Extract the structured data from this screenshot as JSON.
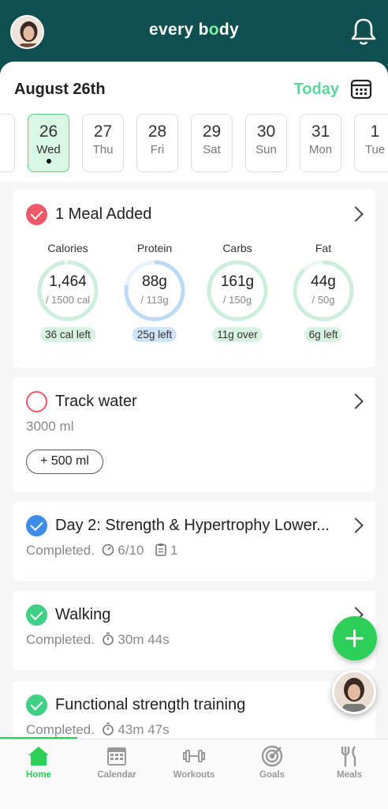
{
  "header": {
    "brand_pre": "every b",
    "brand_o": "o",
    "brand_post": "dy"
  },
  "dates": {
    "title": "August 26th",
    "today_label": "Today",
    "days": [
      {
        "num": "26",
        "name": "Wed",
        "selected": true
      },
      {
        "num": "27",
        "name": "Thu"
      },
      {
        "num": "28",
        "name": "Fri"
      },
      {
        "num": "29",
        "name": "Sat"
      },
      {
        "num": "30",
        "name": "Sun"
      },
      {
        "num": "31",
        "name": "Mon"
      },
      {
        "num": "1",
        "name": "Tue"
      }
    ]
  },
  "meals": {
    "title": "1 Meal Added",
    "macros": [
      {
        "label": "Calories",
        "value": "1,464",
        "total": "/ 1500 cal",
        "remaining": "36 cal left",
        "fraction": 0.98,
        "ring_color": "#cdeedd",
        "pill_color": "#d8f3e2"
      },
      {
        "label": "Protein",
        "value": "88g",
        "total": "/ 113g",
        "remaining": "25g left",
        "fraction": 0.78,
        "ring_color": "#bcd9f5",
        "pill_color": "#cfe4f8"
      },
      {
        "label": "Carbs",
        "value": "161g",
        "total": "/ 150g",
        "remaining": "11g over",
        "fraction": 1.0,
        "ring_color": "#cdeedd",
        "pill_color": "#d8f3e2"
      },
      {
        "label": "Fat",
        "value": "44g",
        "total": "/ 50g",
        "remaining": "6g left",
        "fraction": 0.88,
        "ring_color": "#cdeedd",
        "pill_color": "#d8f3e2"
      }
    ]
  },
  "water": {
    "title": "Track water",
    "amount": "3000 ml",
    "add_button": "+ 500 ml"
  },
  "workout": {
    "title": "Day 2: Strength & Hypertrophy Lower...",
    "status": "Completed.",
    "score": "6/10",
    "notes": "1"
  },
  "walking": {
    "title": "Walking",
    "status": "Completed.",
    "duration": "30m 44s"
  },
  "functional": {
    "title": "Functional strength training",
    "status": "Completed.",
    "duration": "43m 47s"
  },
  "nav": [
    {
      "label": "Home",
      "active": true
    },
    {
      "label": "Calendar"
    },
    {
      "label": "Workouts"
    },
    {
      "label": "Goals"
    },
    {
      "label": "Meals"
    }
  ],
  "colors": {
    "brand_dark": "#0f4f4f",
    "accent_green": "#2ecf58",
    "today_green": "#5ad69e",
    "alert_red": "#ef5868",
    "check_green": "#3fcf85",
    "check_blue": "#3d8ce8"
  }
}
